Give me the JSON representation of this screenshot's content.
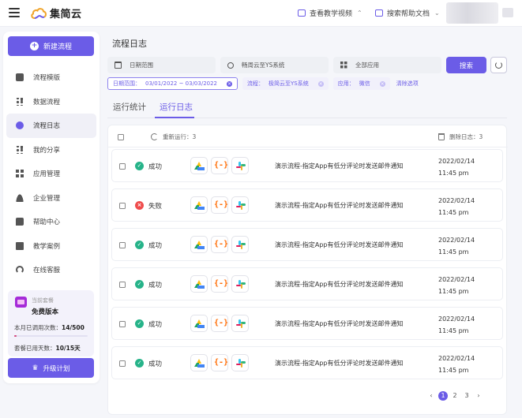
{
  "app": {
    "name": "集简云"
  },
  "topbar": {
    "video_link": "查看教学视频",
    "docs_link": "搜索帮助文档"
  },
  "sidebar": {
    "new_flow_label": "新建流程",
    "items": [
      {
        "label": "流程模版",
        "icon": "template-icon"
      },
      {
        "label": "数据流程",
        "icon": "dataflow-icon"
      },
      {
        "label": "流程日志",
        "icon": "log-icon",
        "active": true
      },
      {
        "label": "我的分享",
        "icon": "share-icon"
      },
      {
        "label": "应用管理",
        "icon": "apps-icon"
      },
      {
        "label": "企业管理",
        "icon": "enterprise-icon"
      },
      {
        "label": "帮助中心",
        "icon": "help-icon"
      },
      {
        "label": "教学案例",
        "icon": "case-icon"
      },
      {
        "label": "在线客服",
        "icon": "support-icon"
      }
    ],
    "plan": {
      "label": "当前套餐",
      "name": "免费版本",
      "usage_label": "本月已调用次数：",
      "usage_value": "14/500",
      "usage_fraction": 0.028,
      "days_label": "套餐已用天数：",
      "days_value": "10/15天"
    },
    "upgrade_label": "升级计划"
  },
  "main": {
    "title": "流程日志",
    "filters": {
      "date_placeholder": "日期范围",
      "search_value": "畅周云至YS系统",
      "app_placeholder": "全部应用",
      "search_button": "搜索"
    },
    "chips": {
      "date_key": "日期范围：",
      "date_value": "03/01/2022 ~ 03/03/2022",
      "flow_key": "流程：",
      "flow_value": "极简云至YS系统",
      "app_key": "应用：",
      "app_value": "微信",
      "clear_label": "清除选项"
    },
    "tabs": [
      "运行统计",
      "运行日志"
    ],
    "list_header": {
      "retry_label": "重新运行：3",
      "delete_label": "删除日志：3"
    },
    "rows": [
      {
        "status": "成功",
        "ok": true,
        "name": "演示流程-指定App有低分评论时发送邮件通知",
        "date": "2022/02/14",
        "time": "11:45 pm"
      },
      {
        "status": "失败",
        "ok": false,
        "name": "演示流程-指定App有低分评论时发送邮件通知",
        "date": "2022/02/14",
        "time": "11:45 pm"
      },
      {
        "status": "成功",
        "ok": true,
        "name": "演示流程-指定App有低分评论时发送邮件通知",
        "date": "2022/02/14",
        "time": "11:45 pm"
      },
      {
        "status": "成功",
        "ok": true,
        "name": "演示流程-指定App有低分评论时发送邮件通知",
        "date": "2022/02/14",
        "time": "11:45 pm"
      },
      {
        "status": "成功",
        "ok": true,
        "name": "演示流程-指定App有低分评论时发送邮件通知",
        "date": "2022/02/14",
        "time": "11:45 pm"
      },
      {
        "status": "成功",
        "ok": true,
        "name": "演示流程-指定App有低分评论时发送邮件通知",
        "date": "2022/02/14",
        "time": "11:45 pm"
      }
    ],
    "pager": {
      "prev": "‹",
      "pages": [
        "1",
        "2",
        "3"
      ],
      "current": "1",
      "next": "›"
    }
  },
  "colors": {
    "accent": "#6b5ce7",
    "success": "#26b389",
    "error": "#ef4c4c"
  }
}
